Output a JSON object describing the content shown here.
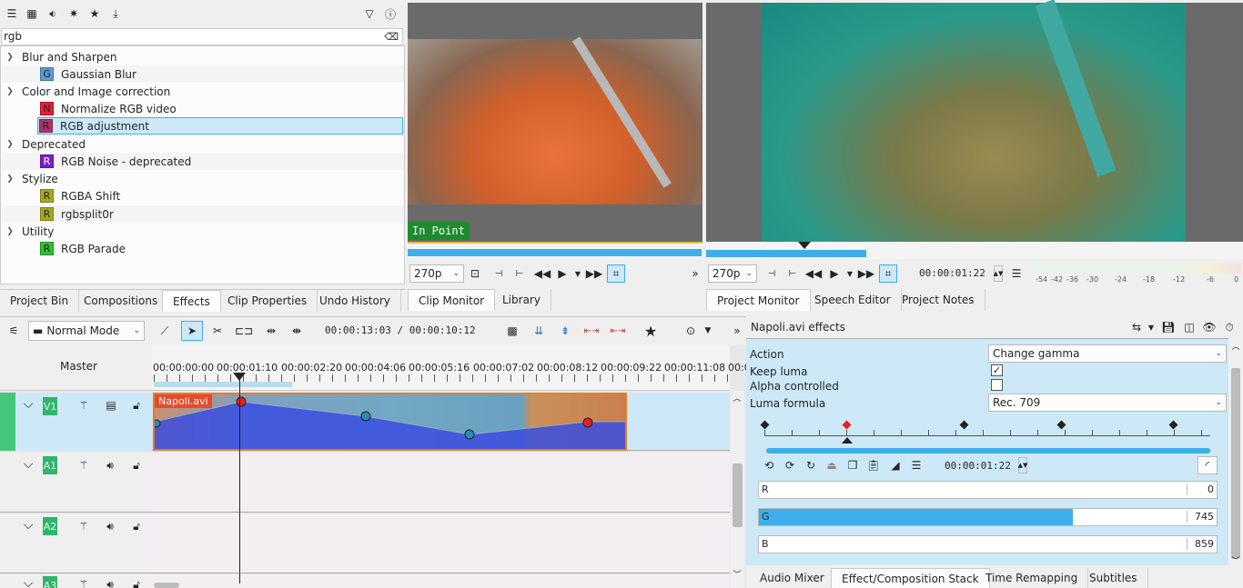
{
  "effects_panel": {
    "search_value": "rgb",
    "categories": [
      {
        "label": "Blur and Sharpen"
      },
      {
        "label": "Color and Image correction"
      },
      {
        "label": "Deprecated"
      },
      {
        "label": "Stylize"
      },
      {
        "label": "Utility"
      }
    ],
    "items": [
      {
        "letter": "G",
        "label": "Gaussian Blur",
        "color": "#5b9bd5"
      },
      {
        "letter": "N",
        "label": "Normalize RGB video",
        "color": "#e0203a"
      },
      {
        "letter": "R",
        "label": "RGB adjustment",
        "color": "#b0306a"
      },
      {
        "letter": "R",
        "label": "RGB Noise - deprecated",
        "color": "#7a20c8"
      },
      {
        "letter": "R",
        "label": "RGBA Shift",
        "color": "#a8a820"
      },
      {
        "letter": "R",
        "label": "rgbsplit0r",
        "color": "#a8a820"
      },
      {
        "letter": "R",
        "label": "RGB Parade",
        "color": "#30c030"
      }
    ]
  },
  "left_tabs": [
    "Project Bin",
    "Compositions",
    "Effects",
    "Clip Properties",
    "Undo History"
  ],
  "clip_monitor": {
    "in_point_label": "In Point",
    "resolution": "270p",
    "tabs": [
      "Clip Monitor",
      "Library"
    ]
  },
  "project_monitor": {
    "resolution": "270p",
    "timecode": "00:00:01:22",
    "tabs": [
      "Project Monitor",
      "Speech Editor",
      "Project Notes"
    ],
    "meter_labels": [
      "-54",
      "-42",
      "-36",
      "-30",
      "-24",
      "-18",
      "-12",
      "-6",
      "0"
    ]
  },
  "timeline_toolbar": {
    "mode": "Normal Mode",
    "timecode": "00:00:13:03 / 00:00:10:12"
  },
  "timeline": {
    "master_label": "Master",
    "ruler": [
      "00:00:00:00",
      "00:00:01:10",
      "00:00:02:20",
      "00:00:04:06",
      "00:00:05:16",
      "00:00:07:02",
      "00:00:08:12",
      "00:00:09:22",
      "00:00:11:08",
      "00:0"
    ],
    "tracks": [
      {
        "name": "V1",
        "type": "video"
      },
      {
        "name": "A1",
        "type": "audio"
      },
      {
        "name": "A2",
        "type": "audio"
      },
      {
        "name": "A3",
        "type": "audio"
      }
    ],
    "clip_name": "Napoli.avi"
  },
  "effect_stack": {
    "title": "Napoli.avi effects",
    "params": [
      {
        "label": "Action",
        "value": "Change gamma"
      },
      {
        "label": "Keep luma",
        "checked": true
      },
      {
        "label": "Alpha controlled",
        "checked": false
      },
      {
        "label": "Luma formula",
        "value": "Rec. 709"
      }
    ],
    "keyframe_timecode": "00:00:01:22",
    "sliders": [
      {
        "label": "R",
        "value": "0",
        "fraction": 0
      },
      {
        "label": "G",
        "value": "745",
        "fraction": 0.745
      },
      {
        "label": "B",
        "value": "859",
        "fraction": 0.859
      }
    ]
  },
  "bottom_right_tabs": [
    "Audio Mixer",
    "Effect/Composition Stack",
    "Time Remapping",
    "Subtitles"
  ],
  "colors": {
    "accent": "#3daee9",
    "selection": "#cde8f6",
    "track_label": "#2fb56c",
    "clip_border": "#e67e22"
  }
}
